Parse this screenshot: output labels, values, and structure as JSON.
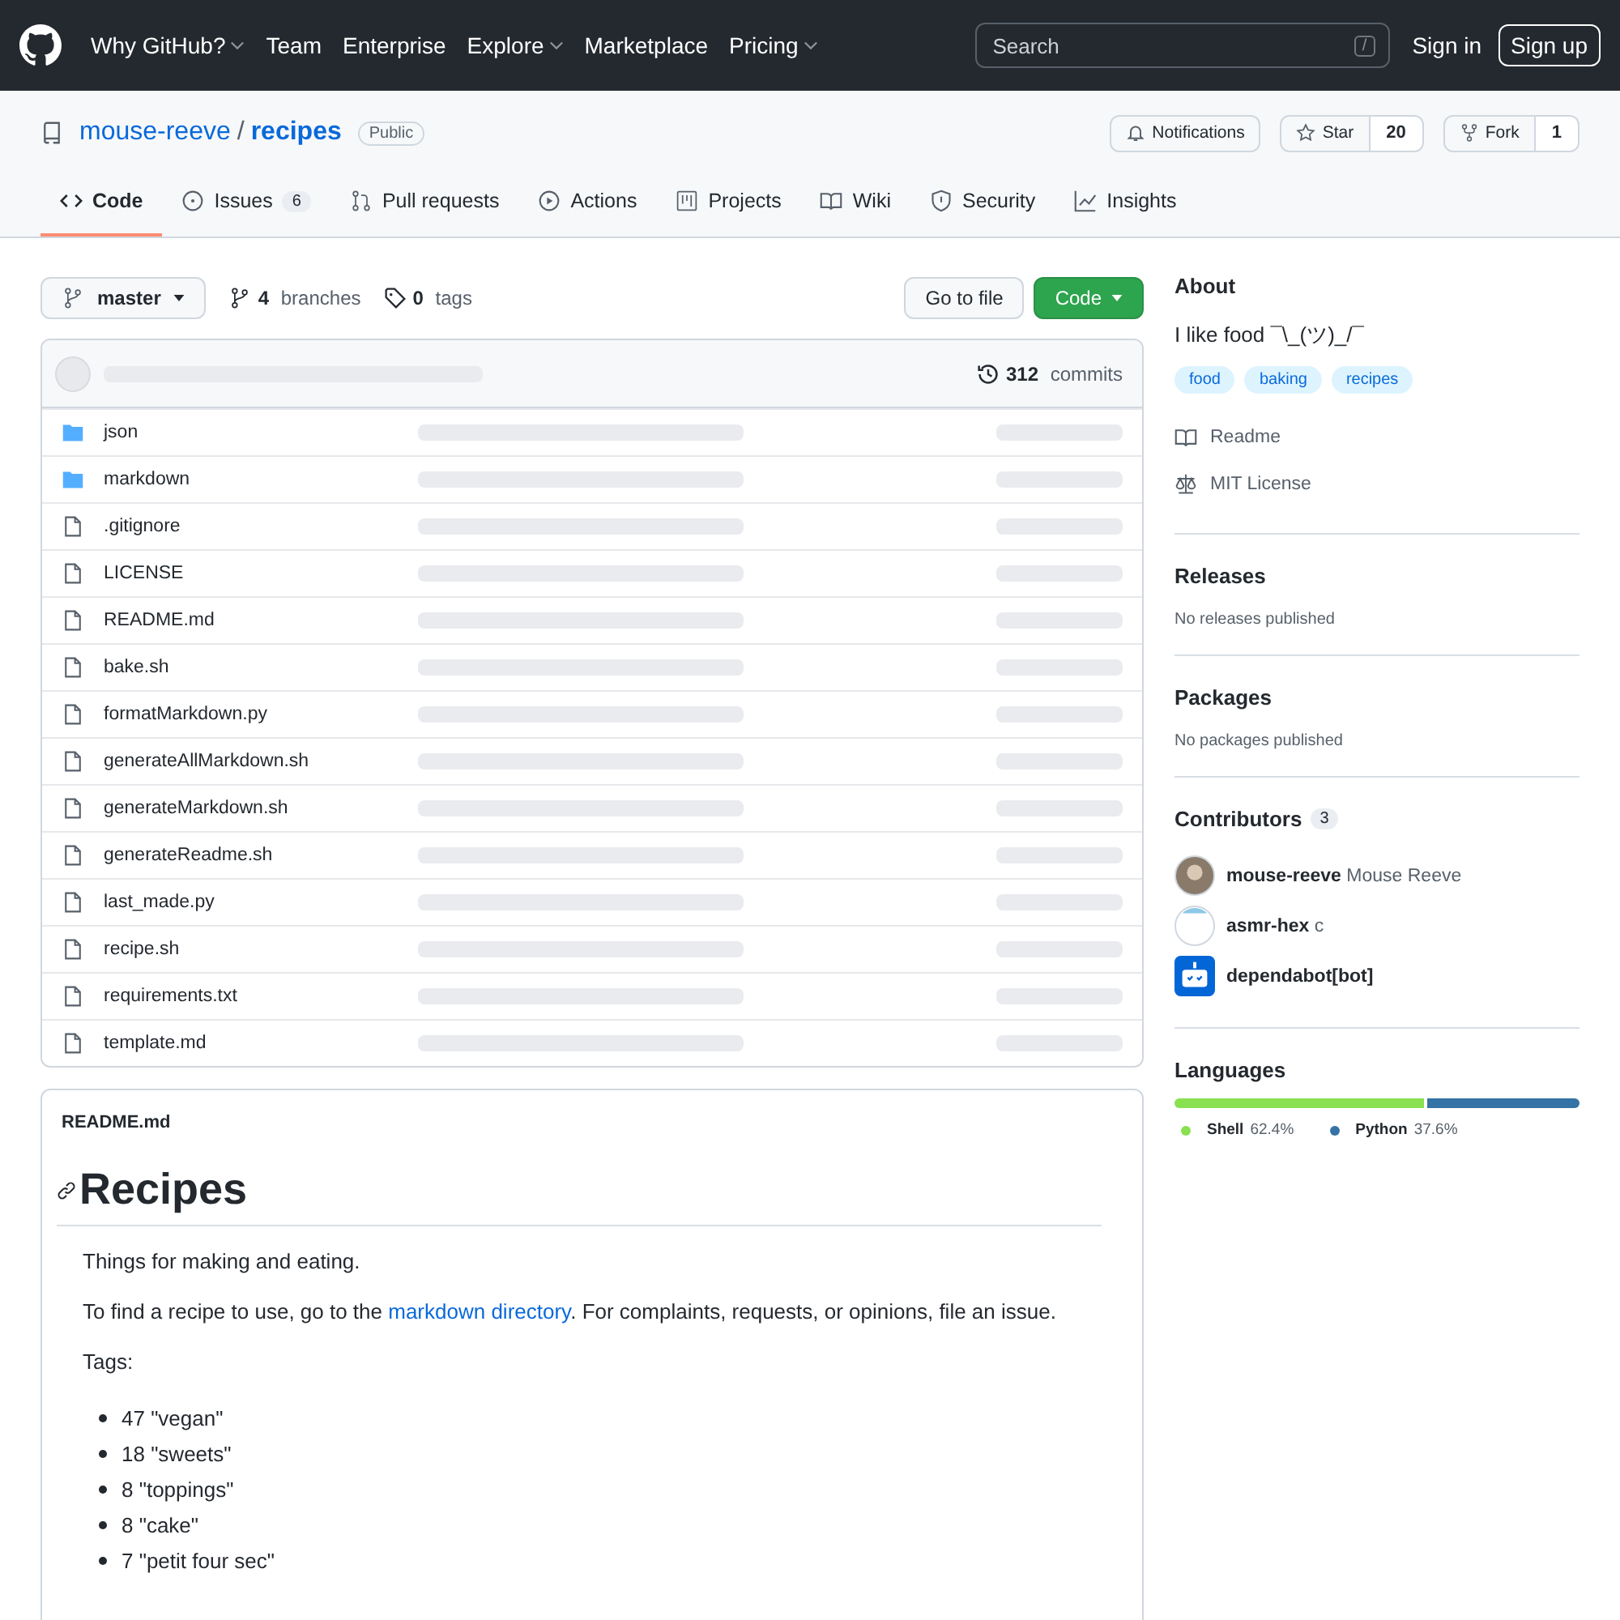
{
  "top_nav": {
    "items": [
      {
        "label": "Why GitHub?",
        "dropdown": true
      },
      {
        "label": "Team",
        "dropdown": false
      },
      {
        "label": "Enterprise",
        "dropdown": false
      },
      {
        "label": "Explore",
        "dropdown": true
      },
      {
        "label": "Marketplace",
        "dropdown": false
      },
      {
        "label": "Pricing",
        "dropdown": true
      }
    ],
    "search": {
      "placeholder": "Search",
      "shortcut": "/"
    },
    "sign_in": "Sign in",
    "sign_up": "Sign up"
  },
  "repo": {
    "owner": "mouse-reeve",
    "separator": "/",
    "name": "recipes",
    "visibility": "Public",
    "notifications": "Notifications",
    "star": "Star",
    "star_count": "20",
    "fork": "Fork",
    "fork_count": "1"
  },
  "tabs": [
    {
      "label": "Code",
      "selected": true
    },
    {
      "label": "Issues",
      "count": "6",
      "selected": false
    },
    {
      "label": "Pull requests",
      "selected": false
    },
    {
      "label": "Actions",
      "selected": false
    },
    {
      "label": "Projects",
      "selected": false
    },
    {
      "label": "Wiki",
      "selected": false
    },
    {
      "label": "Security",
      "selected": false
    },
    {
      "label": "Insights",
      "selected": false
    }
  ],
  "branch_bar": {
    "branch": "master",
    "branches_count": "4",
    "branches_label": "branches",
    "tags_count": "0",
    "tags_label": "tags",
    "go_to_file": "Go to file",
    "code_button": "Code"
  },
  "commits": {
    "count": "312",
    "label": "commits"
  },
  "files": [
    {
      "name": "json",
      "kind": "folder"
    },
    {
      "name": "markdown",
      "kind": "folder"
    },
    {
      "name": ".gitignore",
      "kind": "file"
    },
    {
      "name": "LICENSE",
      "kind": "file"
    },
    {
      "name": "README.md",
      "kind": "file"
    },
    {
      "name": "bake.sh",
      "kind": "file"
    },
    {
      "name": "formatMarkdown.py",
      "kind": "file"
    },
    {
      "name": "generateAllMarkdown.sh",
      "kind": "file"
    },
    {
      "name": "generateMarkdown.sh",
      "kind": "file"
    },
    {
      "name": "generateReadme.sh",
      "kind": "file"
    },
    {
      "name": "last_made.py",
      "kind": "file"
    },
    {
      "name": "recipe.sh",
      "kind": "file"
    },
    {
      "name": "requirements.txt",
      "kind": "file"
    },
    {
      "name": "template.md",
      "kind": "file"
    }
  ],
  "readme": {
    "filename": "README.md",
    "heading": "Recipes",
    "paragraphs": [
      {
        "kind": "text",
        "text": "Things for making and eating."
      },
      {
        "kind": "link",
        "before": "To find a recipe to use, go to the ",
        "link": "markdown directory",
        "after": ". For complaints, requests, or opinions, file an issue."
      },
      {
        "kind": "text",
        "text": "Tags:"
      }
    ],
    "tags": [
      "47 \"vegan\"",
      "18 \"sweets\"",
      "8 \"toppings\"",
      "8 \"cake\"",
      "7 \"petit four sec\""
    ]
  },
  "sidebar": {
    "about": {
      "title": "About",
      "description": "I like food ¯\\_(ツ)_/¯",
      "topics": [
        "food",
        "baking",
        "recipes"
      ],
      "links": [
        "Readme",
        "MIT License"
      ]
    },
    "releases": {
      "title": "Releases",
      "note": "No releases published"
    },
    "packages": {
      "title": "Packages",
      "note": "No packages published"
    },
    "contributors": {
      "title": "Contributors",
      "count": "3",
      "people": [
        {
          "login": "mouse-reeve",
          "name": "Mouse Reeve",
          "kind": "user"
        },
        {
          "login": "asmr-hex",
          "name": "c",
          "kind": "user"
        },
        {
          "login": "dependabot[bot]",
          "kind": "bot"
        }
      ]
    },
    "languages": {
      "title": "Languages",
      "items": [
        {
          "name": "Shell",
          "percent": "62.4%",
          "level": 0.624,
          "color": "#89e051"
        },
        {
          "name": "Python",
          "percent": "37.6%",
          "level": 0.376,
          "color": "#3572a5"
        }
      ]
    }
  }
}
